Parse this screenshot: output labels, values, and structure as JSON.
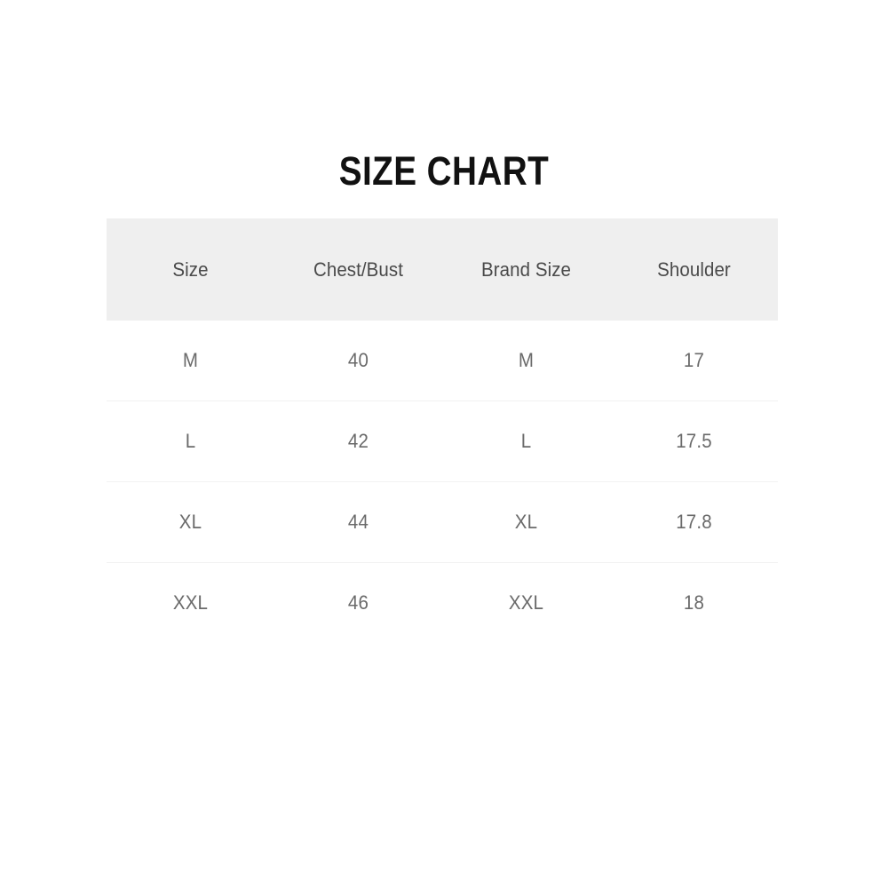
{
  "document": {
    "title": "SIZE CHART",
    "background_color": "#ffffff"
  },
  "table": {
    "header_background": "#efefef",
    "header_text_color": "#4a4a4a",
    "body_text_color": "#6a6a6a",
    "divider_color": "#f2f2f2",
    "columns": [
      {
        "key": "size",
        "label": "Size"
      },
      {
        "key": "chest_bust",
        "label": "Chest/Bust"
      },
      {
        "key": "brand_size",
        "label": "Brand Size"
      },
      {
        "key": "shoulder",
        "label": "Shoulder"
      }
    ],
    "rows": [
      {
        "size": "M",
        "chest_bust": "40",
        "brand_size": "M",
        "shoulder": "17"
      },
      {
        "size": "L",
        "chest_bust": "42",
        "brand_size": "L",
        "shoulder": "17.5"
      },
      {
        "size": "XL",
        "chest_bust": "44",
        "brand_size": "XL",
        "shoulder": "17.8"
      },
      {
        "size": "XXL",
        "chest_bust": "46",
        "brand_size": "XXL",
        "shoulder": "18"
      }
    ]
  },
  "chart_data": {
    "type": "table",
    "title": "SIZE CHART",
    "columns": [
      "Size",
      "Chest/Bust",
      "Brand Size",
      "Shoulder"
    ],
    "rows": [
      [
        "M",
        "40",
        "M",
        "17"
      ],
      [
        "L",
        "42",
        "L",
        "17.5"
      ],
      [
        "XL",
        "44",
        "XL",
        "17.8"
      ],
      [
        "XXL",
        "46",
        "XXL",
        "18"
      ]
    ],
    "series": [
      {
        "name": "Chest/Bust",
        "categories": [
          "M",
          "L",
          "XL",
          "XXL"
        ],
        "values": [
          40,
          42,
          44,
          46
        ]
      },
      {
        "name": "Shoulder",
        "categories": [
          "M",
          "L",
          "XL",
          "XXL"
        ],
        "values": [
          17,
          17.5,
          17.8,
          18
        ]
      }
    ]
  }
}
